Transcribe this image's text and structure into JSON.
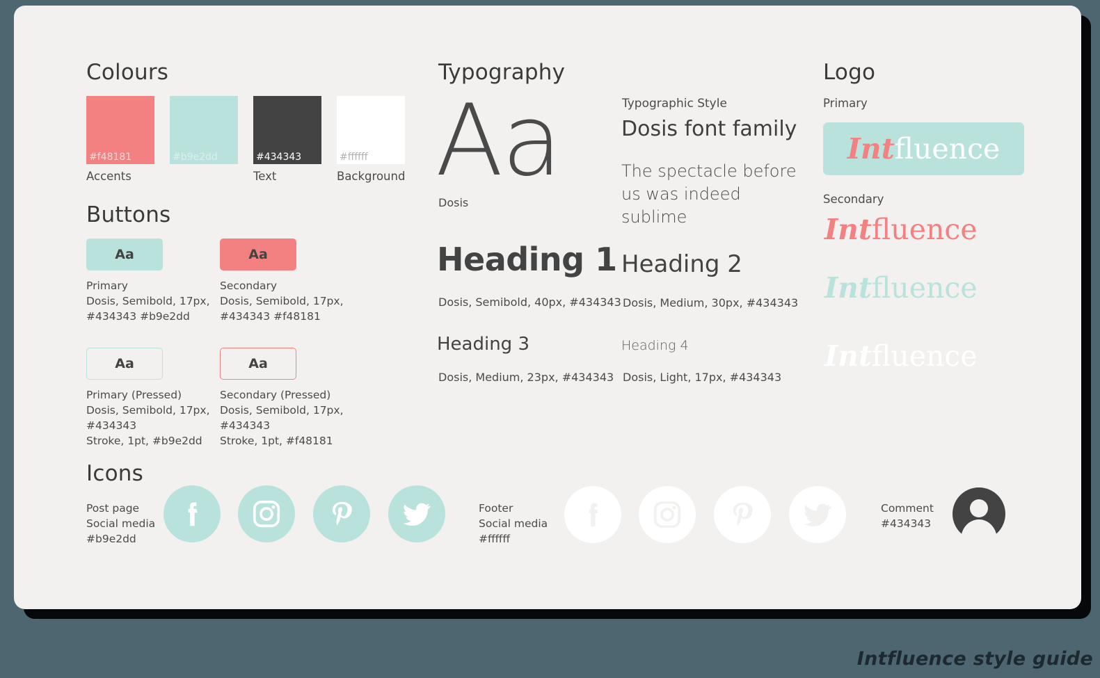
{
  "page": {
    "background_color": "#4d6670",
    "card_background": "#f2f1ef",
    "caption": "Intfluence style guide"
  },
  "colours": {
    "title": "Colours",
    "swatches": [
      {
        "hex": "#f48181",
        "hex_text_color": "#ffd9d9",
        "caption": "Accents"
      },
      {
        "hex": "#b9e2dd",
        "hex_text_color": "#d9f0ed",
        "caption": ""
      },
      {
        "hex": "#434343",
        "hex_text_color": "#ffffff",
        "caption": "Text"
      },
      {
        "hex": "#ffffff",
        "hex_text_color": "#b0b0b0",
        "caption": "Background"
      }
    ]
  },
  "buttons": {
    "title": "Buttons",
    "items": [
      {
        "sample_label": "Aa",
        "fill": "#b9e2dd",
        "border": "none",
        "spec": "Primary\nDosis, Semibold, 17px,\n#434343  #b9e2dd"
      },
      {
        "sample_label": "Aa",
        "fill": "#f48181",
        "border": "none",
        "spec": "Secondary\nDosis, Semibold, 17px,\n#434343 #f48181"
      },
      {
        "sample_label": "Aa",
        "fill": "transparent",
        "border": "#b9e2dd",
        "spec": "Primary (Pressed)\nDosis, Semibold, 17px,\n#434343\nStroke, 1pt, #b9e2dd"
      },
      {
        "sample_label": "Aa",
        "fill": "transparent",
        "border": "#f48181",
        "spec": "Secondary (Pressed)\nDosis, Semibold, 17px,\n#434343\nStroke, 1pt, #f48181"
      }
    ]
  },
  "icons": {
    "title": "Icons",
    "post_page": {
      "caption": "Post page\nSocial media\n#b9e2dd",
      "circle_color": "#b9e2dd",
      "glyph_color": "#ffffff",
      "names": [
        "facebook-icon",
        "instagram-icon",
        "pinterest-icon",
        "twitter-icon"
      ]
    },
    "footer": {
      "caption": "Footer\nSocial media\n#ffffff",
      "circle_color": "#ffffff",
      "glyph_color": "#f2f1ef",
      "names": [
        "facebook-icon",
        "instagram-icon",
        "pinterest-icon",
        "twitter-icon"
      ]
    },
    "comment": {
      "caption": "Comment\n#434343",
      "color": "#434343",
      "name": "avatar-icon"
    }
  },
  "typography": {
    "title": "Typography",
    "specimen": "Aa",
    "specimen_caption": "Dosis",
    "style_label": "Typographic Style",
    "style_title": "Dosis font family",
    "style_body": "The spectacle before us was indeed sublime",
    "headings": [
      {
        "sample": "Heading 1",
        "spec": "Dosis, Semibold, 40px, #434343"
      },
      {
        "sample": "Heading 2",
        "spec": "Dosis, Medium, 30px, #434343"
      },
      {
        "sample": "Heading 3",
        "spec": "Dosis, Medium, 23px, #434343"
      },
      {
        "sample": "Heading 4",
        "spec": "Dosis, Light, 17px, #434343"
      }
    ]
  },
  "logo": {
    "title": "Logo",
    "primary_label": "Primary",
    "secondary_label": "Secondary",
    "wordmark_bold": "Int",
    "wordmark_rest": "fluence",
    "primary": {
      "badge_color": "#b9e2dd",
      "bold_color": "#f48181",
      "rest_color": "#ffffff"
    },
    "variants": [
      {
        "bold_color": "#f48181",
        "rest_color": "#f48181"
      },
      {
        "bold_color": "#b9e2dd",
        "rest_color": "#b9e2dd"
      },
      {
        "bold_color": "#ffffff",
        "rest_color": "#ffffff"
      }
    ]
  }
}
